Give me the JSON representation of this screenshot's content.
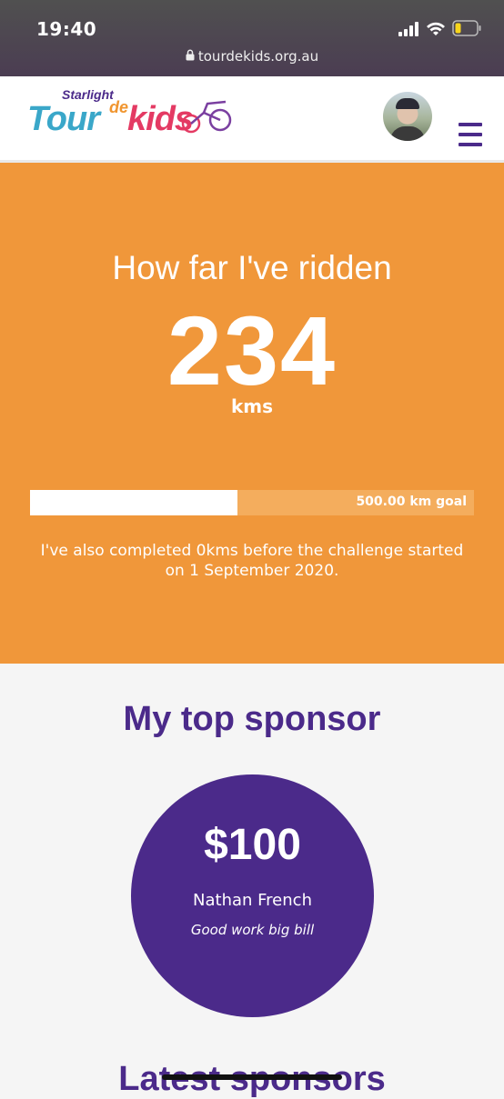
{
  "status_bar": {
    "time": "19:40",
    "url": "tourdekids.org.au",
    "lock_icon": "lock-icon",
    "signal_icon": "cellular-signal-icon",
    "wifi_icon": "wifi-icon",
    "battery_icon": "battery-low-icon"
  },
  "header": {
    "logo": {
      "starlight": "Starlight",
      "tour": "Tour",
      "de": "de",
      "kids": "kids"
    },
    "avatar_label": "profile-photo",
    "menu_icon": "hamburger-menu-icon"
  },
  "hero": {
    "title": "How far I've ridden",
    "distance": "234",
    "unit": "kms",
    "goal_label": "500.00 km goal",
    "progress_fraction": 0.468,
    "note": "I've also completed 0kms before the challenge started on 1 September 2020."
  },
  "sponsor": {
    "heading": "My top sponsor",
    "amount": "$100",
    "name": "Nathan French",
    "message": "Good work big bill"
  },
  "latest": {
    "heading": "Latest sponsors"
  },
  "colors": {
    "orange": "#f0973a",
    "purple": "#4b2a8a",
    "logo_blue": "#3aa7c9",
    "logo_pink": "#e43a63"
  }
}
